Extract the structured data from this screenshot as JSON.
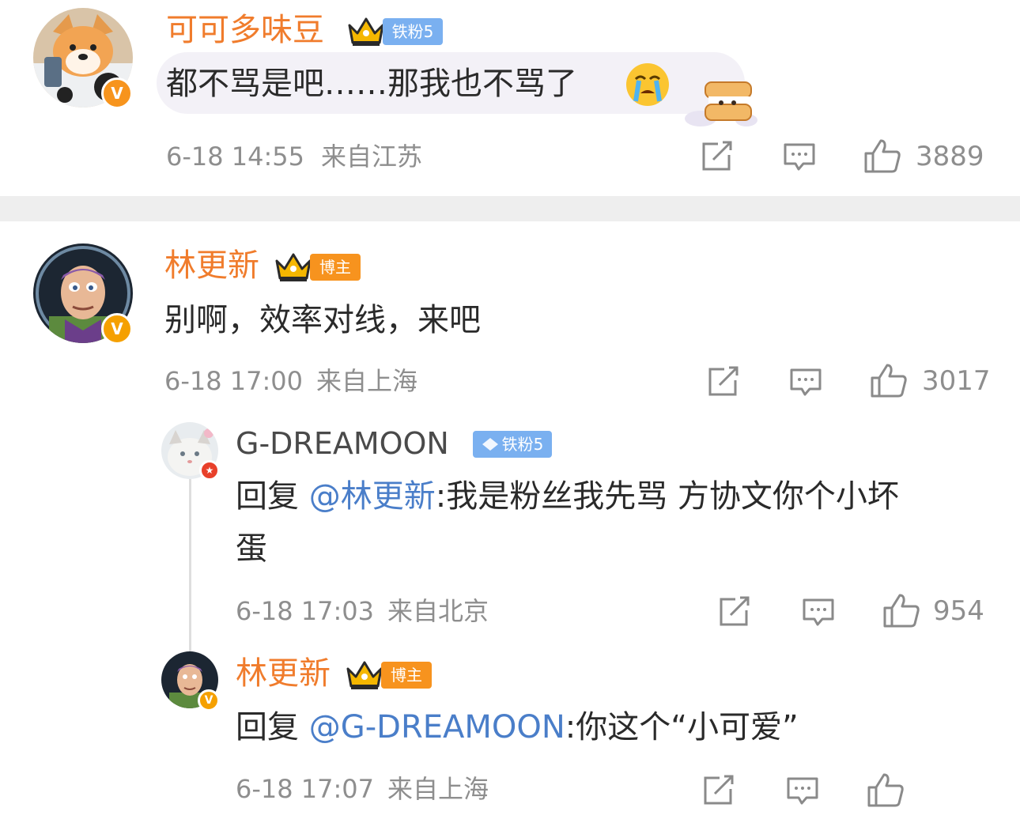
{
  "comments": [
    {
      "username": "可可多味豆",
      "fan_tag": "铁粉5",
      "text": "都不骂是吧……那我也不骂了",
      "time": "6-18 14:55",
      "location": "来自江苏",
      "likes": "3889"
    },
    {
      "username": "林更新",
      "fan_tag": "博主",
      "text": "别啊，效率对线，来吧",
      "time": "6-18 17:00",
      "location": "来自上海",
      "likes": "3017",
      "replies": [
        {
          "username": "G-DREAMOON",
          "fan_tag": "铁粉5",
          "reply_prefix": "回复 ",
          "mention": "@林更新",
          "text_line1": ":我是粉丝我先骂 方协文你个小坏",
          "text_line2": "蛋",
          "time": "6-18 17:03",
          "location": "来自北京",
          "likes": "954"
        },
        {
          "username": "林更新",
          "fan_tag": "博主",
          "reply_prefix": "回复 ",
          "mention": "@G-DREAMOON",
          "text": ":你这个“小可爱”",
          "time": "6-18 17:07",
          "location": "来自上海"
        }
      ]
    }
  ],
  "icons": [
    "share-icon",
    "comment-icon",
    "like-icon",
    "crown-icon",
    "diamond-icon",
    "crying-emoji-icon",
    "sandwich-sticker-icon",
    "verified-v-icon"
  ],
  "colors": {
    "username": "#f07c2c",
    "mention": "#4a7ec9",
    "meta": "#8e8e8e",
    "tag_blue": "#7ab0f0",
    "tag_orange": "#f7931e"
  }
}
